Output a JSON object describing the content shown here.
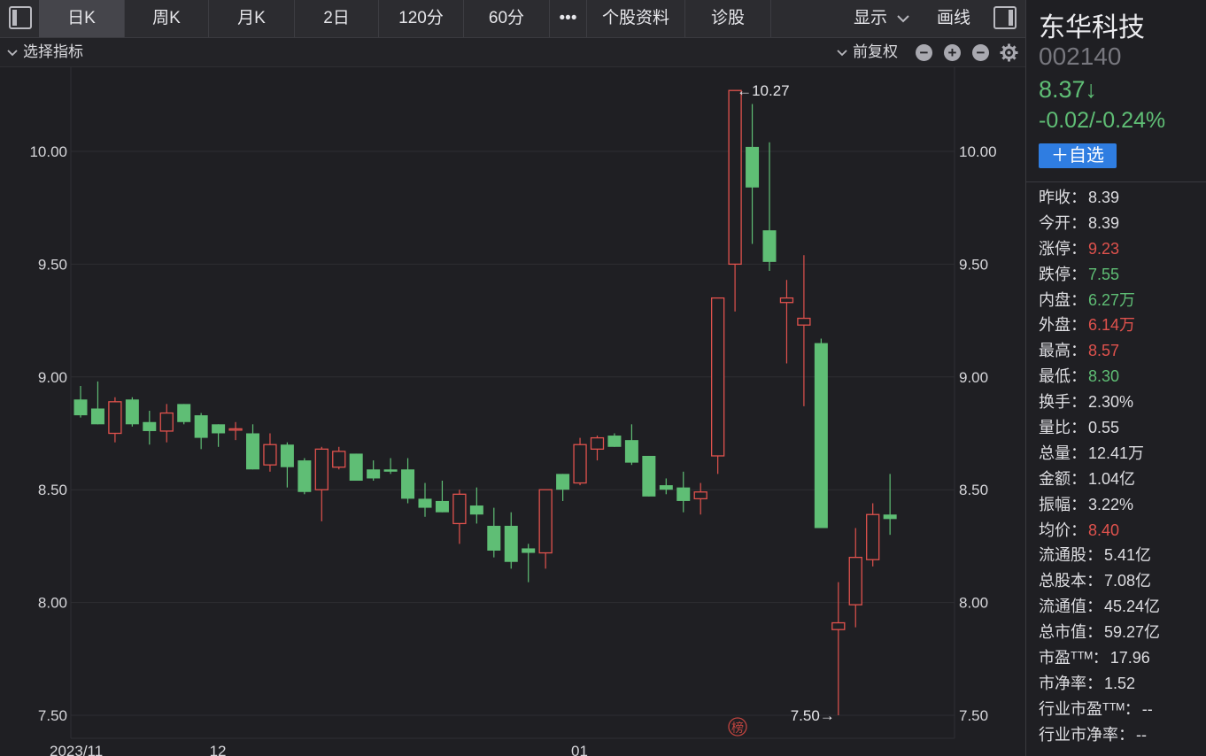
{
  "toolbar": {
    "tabs": [
      "日K",
      "周K",
      "月K",
      "2日",
      "120分",
      "60分",
      "•••",
      "个股资料",
      "诊股"
    ],
    "active_tab": "日K",
    "display_label": "显示",
    "draw_label": "画线"
  },
  "subbar": {
    "indicator_label": "选择指标",
    "adjust_label": "前复权"
  },
  "chart_data": {
    "type": "candlestick",
    "y_ticks": [
      "10.00",
      "9.50",
      "9.00",
      "8.50",
      "8.00",
      "7.50"
    ],
    "y_tick_values": [
      10.0,
      9.5,
      9.0,
      8.5,
      8.0,
      7.5
    ],
    "ylim": [
      7.5,
      10.27
    ],
    "x_labels": [
      {
        "label": "2023/11",
        "index": 0
      },
      {
        "label": "12",
        "index": 8
      },
      {
        "label": "01",
        "index": 29
      }
    ],
    "max_annotation": "←10.27",
    "min_annotation": "7.50→",
    "max_value": 10.27,
    "min_value": 7.5,
    "max_index": 38,
    "min_index": 44,
    "grid": true,
    "badge_text": "榜",
    "up_color": "#e0524d",
    "down_color": "#5fbe75",
    "candles": [
      {
        "o": 8.9,
        "h": 8.96,
        "l": 8.82,
        "c": 8.83
      },
      {
        "o": 8.86,
        "h": 8.98,
        "l": 8.79,
        "c": 8.79
      },
      {
        "o": 8.75,
        "h": 8.91,
        "l": 8.71,
        "c": 8.89
      },
      {
        "o": 8.9,
        "h": 8.91,
        "l": 8.78,
        "c": 8.79
      },
      {
        "o": 8.8,
        "h": 8.85,
        "l": 8.7,
        "c": 8.76
      },
      {
        "o": 8.76,
        "h": 8.88,
        "l": 8.71,
        "c": 8.84
      },
      {
        "o": 8.88,
        "h": 8.88,
        "l": 8.79,
        "c": 8.8
      },
      {
        "o": 8.83,
        "h": 8.84,
        "l": 8.68,
        "c": 8.73
      },
      {
        "o": 8.79,
        "h": 8.79,
        "l": 8.69,
        "c": 8.75
      },
      {
        "o": 8.77,
        "h": 8.8,
        "l": 8.72,
        "c": 8.77
      },
      {
        "o": 8.75,
        "h": 8.79,
        "l": 8.59,
        "c": 8.59
      },
      {
        "o": 8.61,
        "h": 8.75,
        "l": 8.58,
        "c": 8.7
      },
      {
        "o": 8.7,
        "h": 8.71,
        "l": 8.51,
        "c": 8.6
      },
      {
        "o": 8.63,
        "h": 8.64,
        "l": 8.48,
        "c": 8.49
      },
      {
        "o": 8.5,
        "h": 8.69,
        "l": 8.36,
        "c": 8.68
      },
      {
        "o": 8.6,
        "h": 8.69,
        "l": 8.59,
        "c": 8.67
      },
      {
        "o": 8.66,
        "h": 8.66,
        "l": 8.54,
        "c": 8.54
      },
      {
        "o": 8.59,
        "h": 8.63,
        "l": 8.54,
        "c": 8.55
      },
      {
        "o": 8.59,
        "h": 8.64,
        "l": 8.57,
        "c": 8.58
      },
      {
        "o": 8.59,
        "h": 8.64,
        "l": 8.44,
        "c": 8.46
      },
      {
        "o": 8.46,
        "h": 8.53,
        "l": 8.38,
        "c": 8.42
      },
      {
        "o": 8.45,
        "h": 8.54,
        "l": 8.4,
        "c": 8.4
      },
      {
        "o": 8.35,
        "h": 8.5,
        "l": 8.26,
        "c": 8.48
      },
      {
        "o": 8.43,
        "h": 8.51,
        "l": 8.35,
        "c": 8.39
      },
      {
        "o": 8.34,
        "h": 8.42,
        "l": 8.2,
        "c": 8.23
      },
      {
        "o": 8.34,
        "h": 8.4,
        "l": 8.15,
        "c": 8.18
      },
      {
        "o": 8.24,
        "h": 8.26,
        "l": 8.09,
        "c": 8.22
      },
      {
        "o": 8.22,
        "h": 8.5,
        "l": 8.15,
        "c": 8.5
      },
      {
        "o": 8.57,
        "h": 8.57,
        "l": 8.45,
        "c": 8.5
      },
      {
        "o": 8.53,
        "h": 8.73,
        "l": 8.52,
        "c": 8.7
      },
      {
        "o": 8.68,
        "h": 8.74,
        "l": 8.63,
        "c": 8.73
      },
      {
        "o": 8.74,
        "h": 8.75,
        "l": 8.69,
        "c": 8.69
      },
      {
        "o": 8.72,
        "h": 8.79,
        "l": 8.61,
        "c": 8.62
      },
      {
        "o": 8.65,
        "h": 8.65,
        "l": 8.47,
        "c": 8.47
      },
      {
        "o": 8.52,
        "h": 8.55,
        "l": 8.48,
        "c": 8.5
      },
      {
        "o": 8.51,
        "h": 8.58,
        "l": 8.4,
        "c": 8.45
      },
      {
        "o": 8.46,
        "h": 8.53,
        "l": 8.39,
        "c": 8.49
      },
      {
        "o": 8.65,
        "h": 9.35,
        "l": 8.57,
        "c": 9.35
      },
      {
        "o": 9.5,
        "h": 10.27,
        "l": 9.29,
        "c": 10.27
      },
      {
        "o": 10.02,
        "h": 10.21,
        "l": 9.59,
        "c": 9.84
      },
      {
        "o": 9.65,
        "h": 10.04,
        "l": 9.47,
        "c": 9.51
      },
      {
        "o": 9.33,
        "h": 9.43,
        "l": 9.06,
        "c": 9.35
      },
      {
        "o": 9.23,
        "h": 9.54,
        "l": 8.87,
        "c": 9.26
      },
      {
        "o": 9.15,
        "h": 9.17,
        "l": 8.33,
        "c": 8.33
      },
      {
        "o": 7.88,
        "h": 8.09,
        "l": 7.5,
        "c": 7.91
      },
      {
        "o": 7.99,
        "h": 8.33,
        "l": 7.89,
        "c": 8.2
      },
      {
        "o": 8.19,
        "h": 8.44,
        "l": 8.16,
        "c": 8.39
      },
      {
        "o": 8.39,
        "h": 8.57,
        "l": 8.3,
        "c": 8.37
      }
    ]
  },
  "stock": {
    "name": "东华科技",
    "code": "002140",
    "price": "8.37↓",
    "change": "-0.02/-0.24%",
    "watch_label": "＋自选"
  },
  "stats": [
    {
      "label": "昨收：",
      "value": "8.39",
      "color": "neutral"
    },
    {
      "label": "今开：",
      "value": "8.39",
      "color": "neutral"
    },
    {
      "label": "涨停：",
      "value": "9.23",
      "color": "up"
    },
    {
      "label": "跌停：",
      "value": "7.55",
      "color": "down"
    },
    {
      "label": "内盘：",
      "value": "6.27万",
      "color": "down"
    },
    {
      "label": "外盘：",
      "value": "6.14万",
      "color": "up"
    },
    {
      "label": "最高：",
      "value": "8.57",
      "color": "up"
    },
    {
      "label": "最低：",
      "value": "8.30",
      "color": "down"
    },
    {
      "label": "换手：",
      "value": "2.30%",
      "color": "neutral"
    },
    {
      "label": "量比：",
      "value": "0.55",
      "color": "neutral"
    },
    {
      "label": "总量：",
      "value": "12.41万",
      "color": "neutral"
    },
    {
      "label": "金额：",
      "value": "1.04亿",
      "color": "neutral"
    },
    {
      "label": "振幅：",
      "value": "3.22%",
      "color": "neutral"
    },
    {
      "label": "均价：",
      "value": "8.40",
      "color": "up"
    },
    {
      "label": "流通股：",
      "value": "5.41亿",
      "color": "neutral"
    },
    {
      "label": "总股本：",
      "value": "7.08亿",
      "color": "neutral"
    },
    {
      "label": "流通值：",
      "value": "45.24亿",
      "color": "neutral"
    },
    {
      "label": "总市值：",
      "value": "59.27亿",
      "color": "neutral"
    },
    {
      "label": "市盈ᵀᵀᴹ：",
      "value": "17.96",
      "color": "neutral"
    },
    {
      "label": "市净率：",
      "value": "1.52",
      "color": "neutral"
    },
    {
      "label": "行业市盈ᵀᵀᴹ：",
      "value": "--",
      "color": "neutral"
    },
    {
      "label": "行业市净率：",
      "value": "--",
      "color": "neutral"
    }
  ]
}
